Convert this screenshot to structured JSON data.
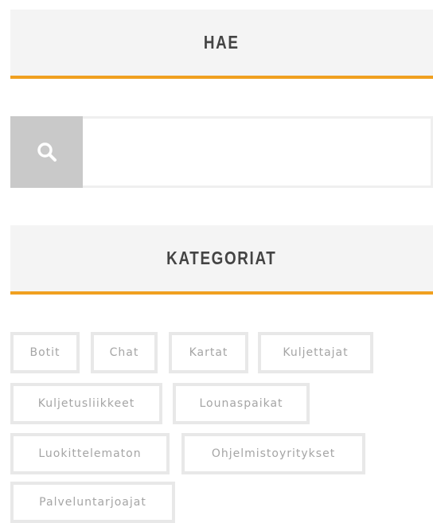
{
  "search_widget": {
    "title": "HAE",
    "input_value": "",
    "icon": "search-icon"
  },
  "categories_widget": {
    "title": "KATEGORIAT",
    "tags": [
      "Botit",
      "Chat",
      "Kartat",
      "Kuljettajat",
      "Kuljetusliikkeet",
      "Lounaspaikat",
      "Luokittelematon",
      "Ohjelmistoyritykset",
      "Palveluntarjoajat"
    ]
  },
  "colors": {
    "accent": "#f0a020",
    "header_bg": "#f4f4f4",
    "search_button_bg": "#c9c9c9",
    "tag_border": "#e8e8e8",
    "tag_text": "#a5a5a5"
  }
}
